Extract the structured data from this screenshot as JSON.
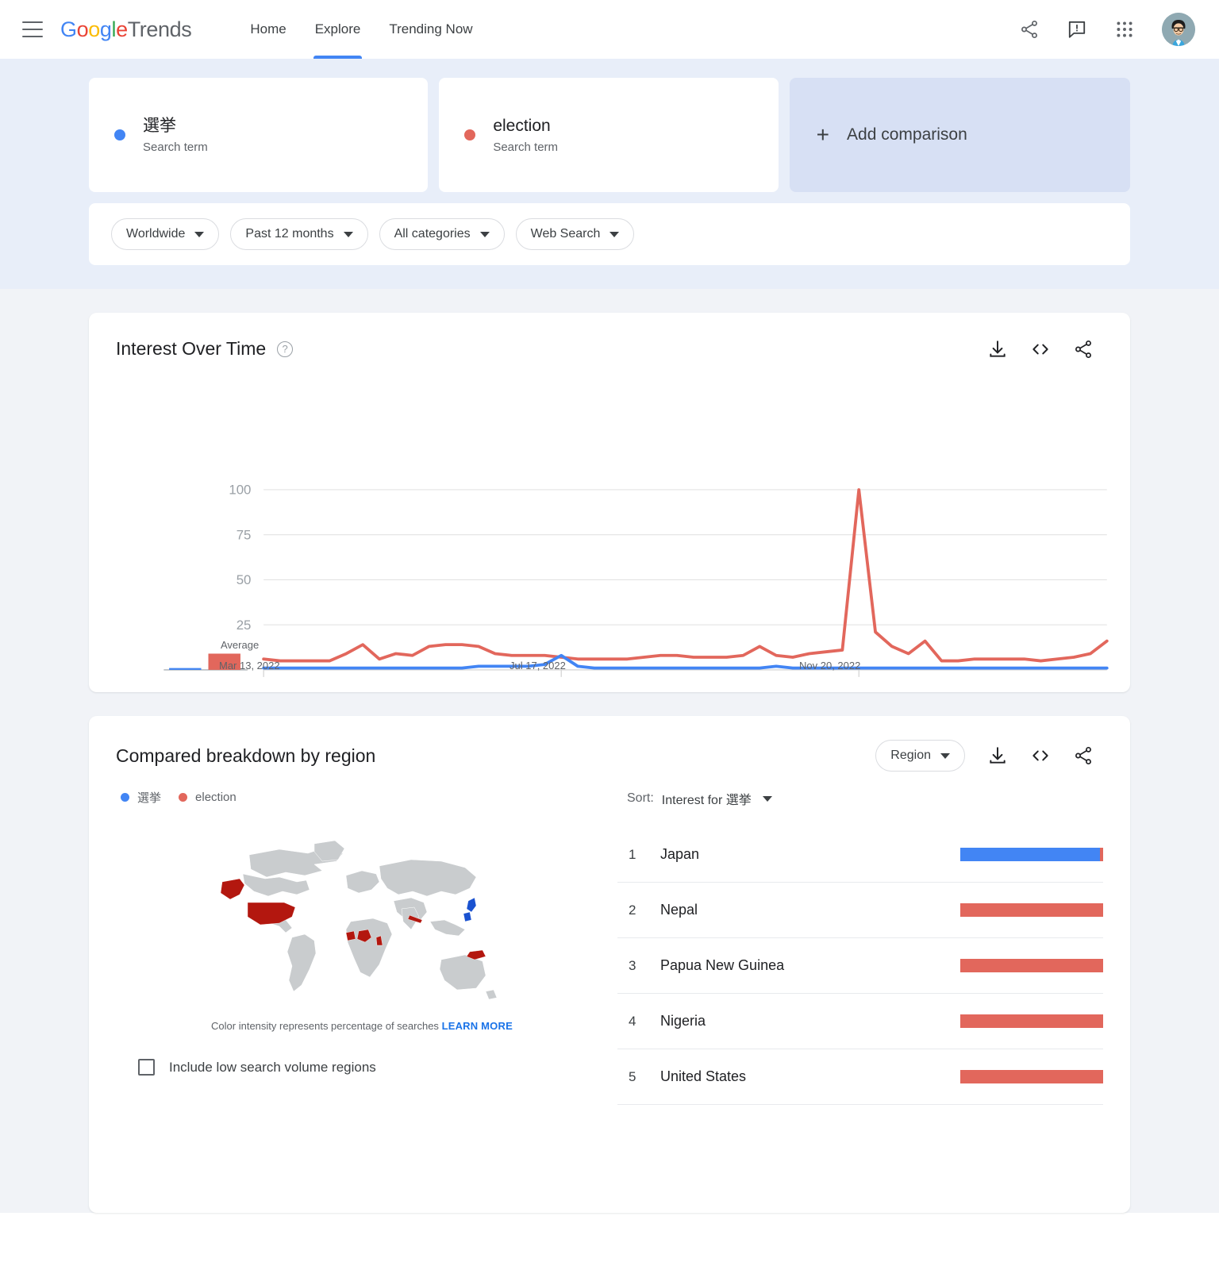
{
  "colors": {
    "blue": "#4285F4",
    "red": "#E2675C",
    "map_red": "#B3170F",
    "map_gray": "#C9CCCE",
    "accent_link": "#1a73e8"
  },
  "header": {
    "menu_icon": "hamburger-icon",
    "logo": {
      "g1": "G",
      "o1": "o",
      "o2": "o",
      "g2": "g",
      "l": "l",
      "e": "e",
      "trends": "Trends"
    },
    "nav": [
      {
        "label": "Home",
        "active": false
      },
      {
        "label": "Explore",
        "active": true
      },
      {
        "label": "Trending Now",
        "active": false
      }
    ],
    "icons": [
      "share-icon",
      "feedback-icon",
      "apps-grid-icon",
      "avatar"
    ]
  },
  "query": {
    "terms": [
      {
        "name": "選挙",
        "type": "Search term",
        "color": "#4285F4"
      },
      {
        "name": "election",
        "type": "Search term",
        "color": "#E2675C"
      }
    ],
    "add_comparison": "Add comparison",
    "filters": [
      {
        "label": "Worldwide"
      },
      {
        "label": "Past 12 months"
      },
      {
        "label": "All categories"
      },
      {
        "label": "Web Search"
      }
    ]
  },
  "interest_over_time": {
    "title": "Interest Over Time",
    "help_glyph": "?",
    "actions": [
      "download-icon",
      "embed-code-icon",
      "share-icon"
    ],
    "average_label": "Average"
  },
  "region": {
    "title": "Compared breakdown by region",
    "region_dropdown": "Region",
    "actions": [
      "download-icon",
      "embed-code-icon",
      "share-icon"
    ],
    "legend": [
      {
        "label": "選挙",
        "color": "#4285F4"
      },
      {
        "label": "election",
        "color": "#E2675C"
      }
    ],
    "sort_label": "Sort:",
    "sort_value": "Interest for 選挙",
    "rows": [
      {
        "rank": "1",
        "name": "Japan",
        "blue": 98,
        "red": 2
      },
      {
        "rank": "2",
        "name": "Nepal",
        "blue": 0,
        "red": 100
      },
      {
        "rank": "3",
        "name": "Papua New Guinea",
        "blue": 0,
        "red": 100
      },
      {
        "rank": "4",
        "name": "Nigeria",
        "blue": 0,
        "red": 100
      },
      {
        "rank": "5",
        "name": "United States",
        "blue": 0,
        "red": 100
      }
    ],
    "map_note_text": "Color intensity represents percentage of searches",
    "map_note_link": "LEARN MORE",
    "checkbox_label": "Include low search volume regions",
    "checkbox_checked": false
  },
  "chart_data": {
    "type": "line",
    "title": "Interest Over Time",
    "xlabel": "",
    "ylabel": "",
    "ylim": [
      0,
      100
    ],
    "grid": true,
    "legend_position": "top-left",
    "tick_labels_y": [
      "100",
      "75",
      "50",
      "25"
    ],
    "tick_labels_x": [
      "Mar 13, 2022",
      "Jul 17, 2022",
      "Nov 20, 2022"
    ],
    "x_tick_index": [
      0,
      18,
      36
    ],
    "x": [
      "Mar 13, 2022",
      "Mar 20, 2022",
      "Mar 27, 2022",
      "Apr 3, 2022",
      "Apr 10, 2022",
      "Apr 17, 2022",
      "Apr 24, 2022",
      "May 1, 2022",
      "May 8, 2022",
      "May 15, 2022",
      "May 22, 2022",
      "May 29, 2022",
      "Jun 5, 2022",
      "Jun 12, 2022",
      "Jun 19, 2022",
      "Jun 26, 2022",
      "Jul 3, 2022",
      "Jul 10, 2022",
      "Jul 17, 2022",
      "Jul 24, 2022",
      "Jul 31, 2022",
      "Aug 7, 2022",
      "Aug 14, 2022",
      "Aug 21, 2022",
      "Aug 28, 2022",
      "Sep 4, 2022",
      "Sep 11, 2022",
      "Sep 18, 2022",
      "Sep 25, 2022",
      "Oct 2, 2022",
      "Oct 9, 2022",
      "Oct 16, 2022",
      "Oct 23, 2022",
      "Oct 30, 2022",
      "Nov 6, 2022",
      "Nov 13, 2022",
      "Nov 20, 2022",
      "Nov 27, 2022",
      "Dec 4, 2022",
      "Dec 11, 2022",
      "Dec 18, 2022",
      "Dec 25, 2022",
      "Jan 1, 2023",
      "Jan 8, 2023",
      "Jan 15, 2023",
      "Jan 22, 2023",
      "Jan 29, 2023",
      "Feb 5, 2023",
      "Feb 12, 2023",
      "Feb 19, 2023",
      "Feb 26, 2023",
      "Mar 5, 2023"
    ],
    "series": [
      {
        "name": "選挙",
        "color": "#4285F4",
        "average": 1,
        "values": [
          1,
          1,
          1,
          1,
          1,
          1,
          1,
          1,
          1,
          1,
          1,
          1,
          1,
          2,
          2,
          2,
          2,
          3,
          8,
          2,
          1,
          1,
          1,
          1,
          1,
          1,
          1,
          1,
          1,
          1,
          1,
          2,
          1,
          1,
          1,
          1,
          1,
          1,
          1,
          1,
          1,
          1,
          1,
          1,
          1,
          1,
          1,
          1,
          1,
          1,
          1,
          1
        ]
      },
      {
        "name": "election",
        "color": "#E2675C",
        "average": 9,
        "values": [
          6,
          5,
          5,
          5,
          5,
          9,
          14,
          6,
          9,
          8,
          13,
          14,
          14,
          13,
          9,
          8,
          8,
          8,
          7,
          6,
          6,
          6,
          6,
          7,
          8,
          8,
          7,
          7,
          7,
          8,
          13,
          8,
          7,
          9,
          10,
          11,
          100,
          21,
          13,
          9,
          16,
          5,
          5,
          6,
          6,
          6,
          6,
          5,
          6,
          7,
          9,
          16
        ]
      }
    ]
  }
}
